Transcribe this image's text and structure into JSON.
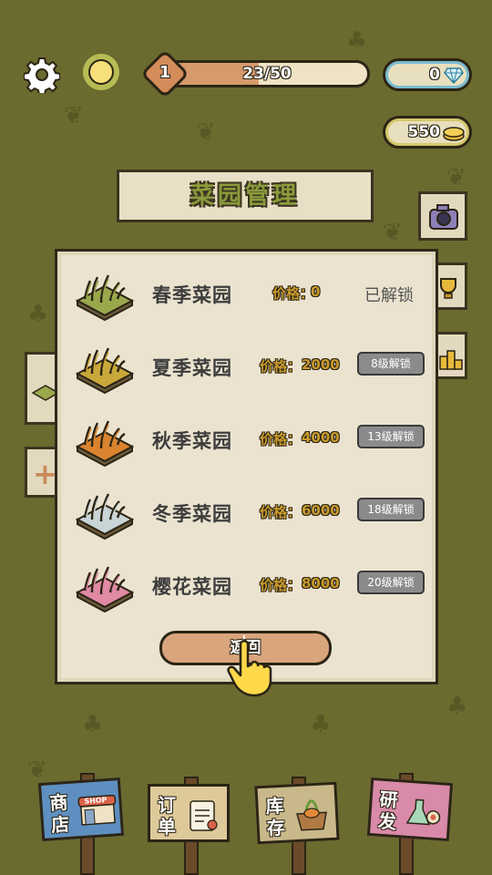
{
  "top_bar": {
    "level": "1",
    "xp_text": "23/50",
    "xp_progress": 0.46,
    "diamonds": "0",
    "gold": "550",
    "icons": [
      "gear-icon",
      "sun-icon",
      "diamond-icon",
      "gold-coin-icon"
    ]
  },
  "title": "菜园管理",
  "gardens": [
    {
      "name": "春季菜园",
      "price_label": "价格：",
      "price": "0",
      "status": "已解锁",
      "locked": false,
      "color": "#9aa84c"
    },
    {
      "name": "夏季菜园",
      "price_label": "价格：",
      "price": "2000",
      "status": "8级解锁",
      "locked": true,
      "color": "#c9a83a"
    },
    {
      "name": "秋季菜园",
      "price_label": "价格：",
      "price": "4000",
      "status": "13级解锁",
      "locked": true,
      "color": "#d9832e"
    },
    {
      "name": "冬季菜园",
      "price_label": "价格：",
      "price": "6000",
      "status": "18级解锁",
      "locked": true,
      "color": "#c9d4d6"
    },
    {
      "name": "樱花菜园",
      "price_label": "价格：",
      "price": "8000",
      "status": "20级解锁",
      "locked": true,
      "color": "#e08aa4"
    }
  ],
  "return_button": "返回",
  "bottom_nav": [
    {
      "label_1": "商",
      "label_2": "店",
      "icon": "shop-icon",
      "color": "#5e8fc0"
    },
    {
      "label_1": "订",
      "label_2": "单",
      "icon": "order-icon",
      "color": "#ddc99a"
    },
    {
      "label_1": "库",
      "label_2": "存",
      "icon": "storage-icon",
      "color": "#c9b88a"
    },
    {
      "label_1": "研",
      "label_2": "发",
      "icon": "research-icon",
      "color": "#d88aa8"
    }
  ],
  "shop_sign_text": "SHOP"
}
